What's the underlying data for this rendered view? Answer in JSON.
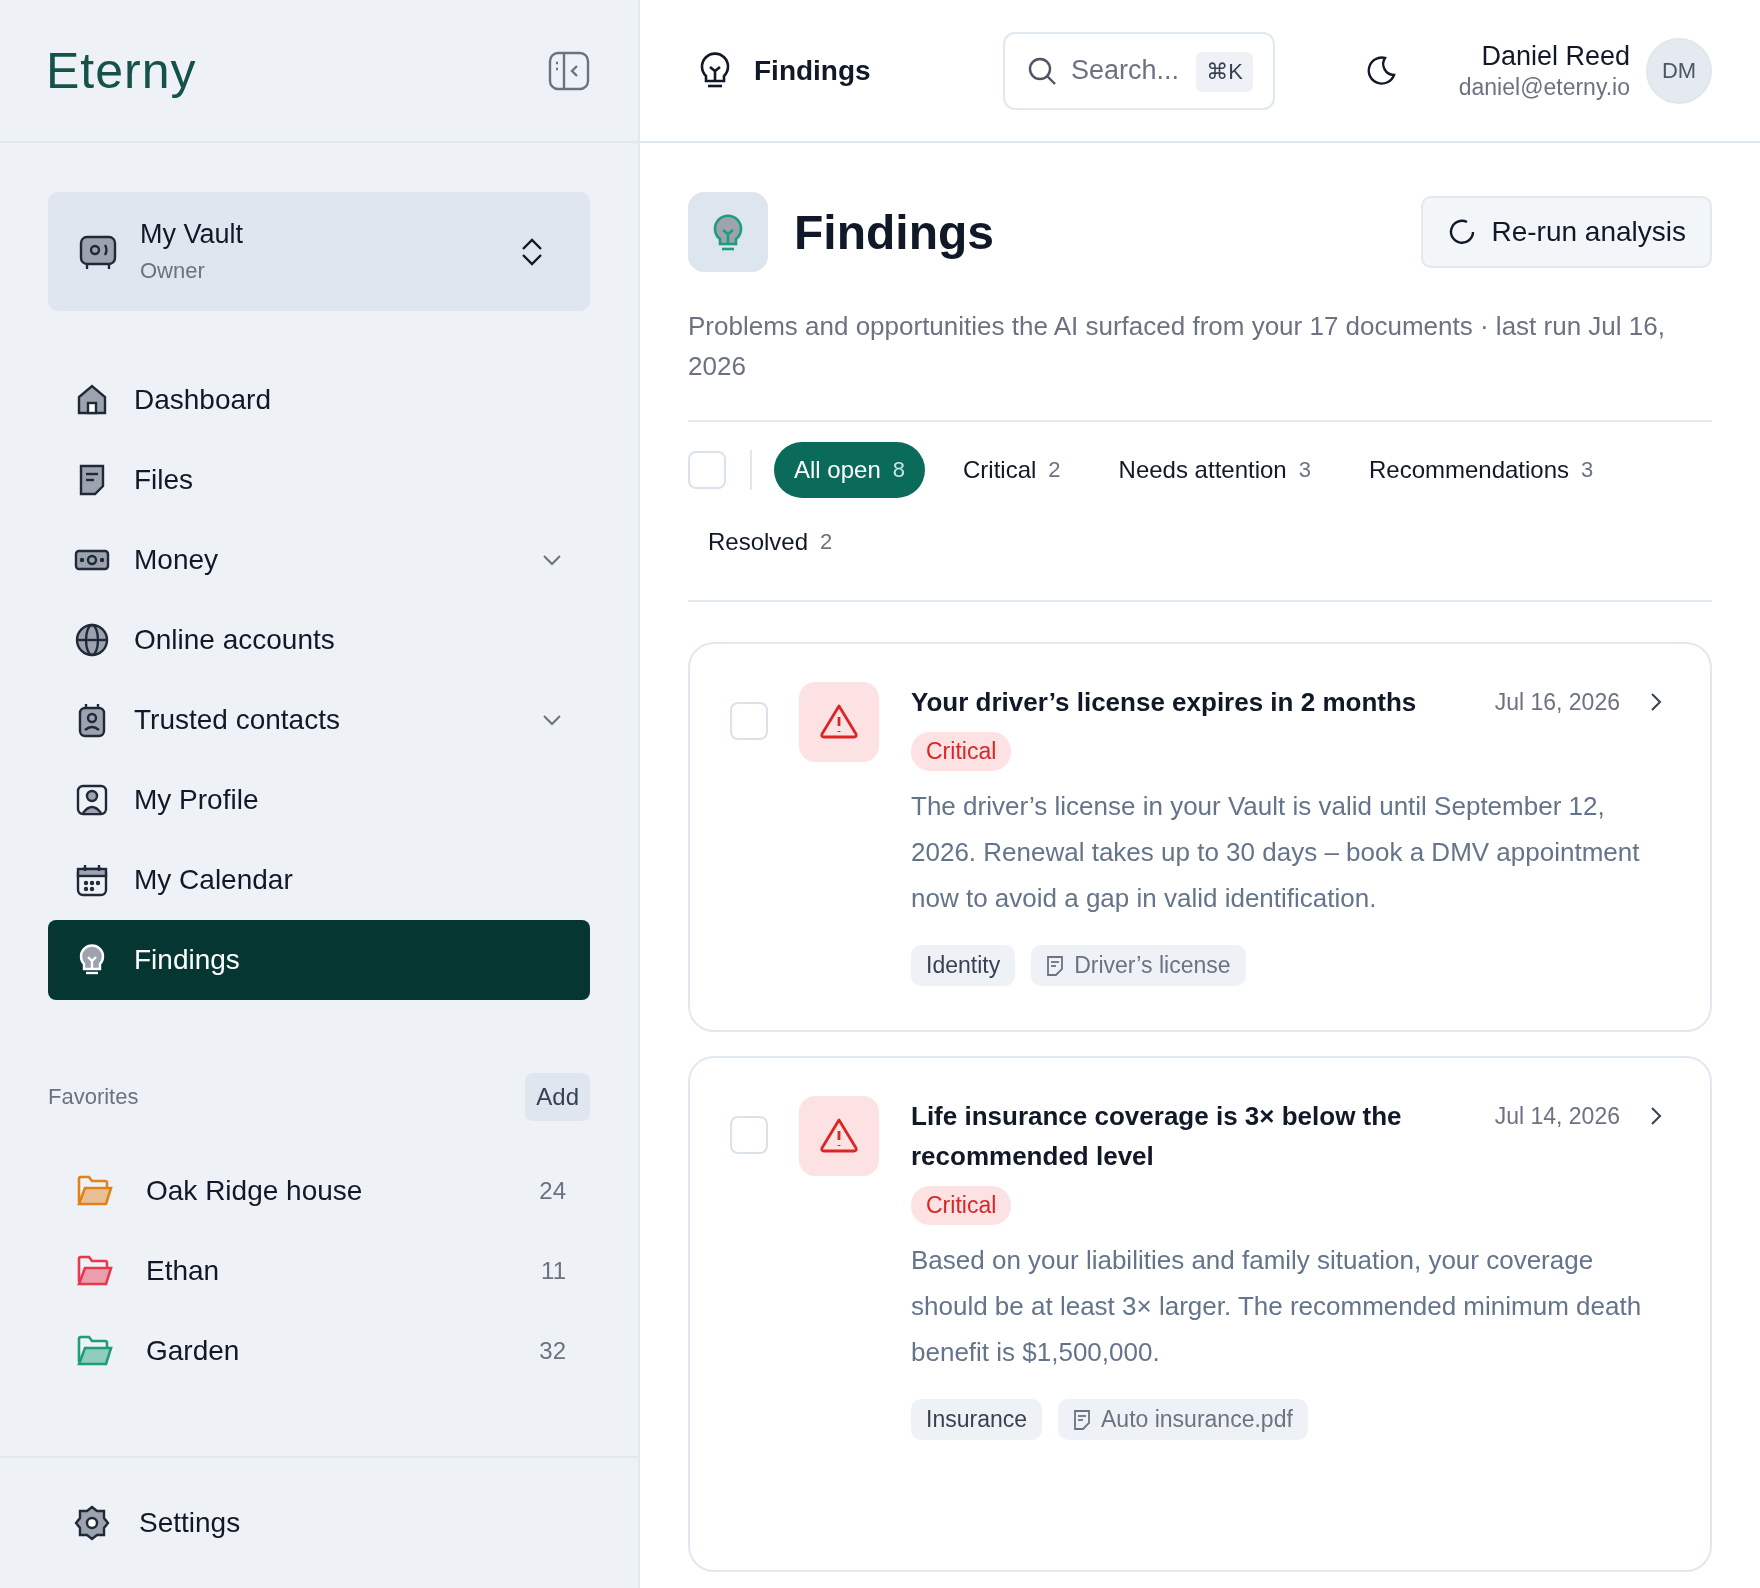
{
  "sidebar": {
    "logo": "Eterny",
    "vault": {
      "name": "My Vault",
      "role": "Owner"
    },
    "nav": [
      {
        "label": "Dashboard",
        "kind": "link",
        "selected": false
      },
      {
        "label": "Files",
        "kind": "link",
        "selected": false
      },
      {
        "label": "Money",
        "kind": "group",
        "selected": false
      },
      {
        "label": "Online accounts",
        "kind": "link",
        "selected": false
      },
      {
        "label": "Trusted contacts",
        "kind": "group",
        "selected": false
      },
      {
        "label": "My Profile",
        "kind": "link",
        "selected": false
      },
      {
        "label": "My Calendar",
        "kind": "link",
        "selected": false
      },
      {
        "label": "Findings",
        "kind": "link",
        "selected": true
      }
    ],
    "favorites": {
      "title": "Favorites",
      "add_button": "Add",
      "items": [
        {
          "name": "Oak Ridge house",
          "count": "24",
          "color": "#e0811a"
        },
        {
          "name": "Ethan",
          "count": "11",
          "color": "#e8384f"
        },
        {
          "name": "Garden",
          "count": "32",
          "color": "#1f9d7a"
        }
      ]
    },
    "settings": "Settings"
  },
  "header": {
    "title": "Findings",
    "search": {
      "placeholder": "Search...",
      "shortcut": "⌘K"
    },
    "user": {
      "name": "Daniel Reed",
      "email": "daniel@eterny.io",
      "initials": "DM"
    }
  },
  "page": {
    "title": "Findings",
    "rerun_button": "Re-run analysis",
    "subtitle": "Problems and opportunities the AI surfaced from your 17 documents · last run Jul 16, 2026",
    "select_all": {
      "checked": false
    },
    "tabs": [
      {
        "label": "All open",
        "count": "8",
        "selected": true
      },
      {
        "label": "Critical",
        "count": "2",
        "selected": false
      },
      {
        "label": "Needs attention",
        "count": "3",
        "selected": false
      },
      {
        "label": "Recommendations",
        "count": "3",
        "selected": false
      },
      {
        "label": "Resolved",
        "count": "2",
        "selected": false
      }
    ],
    "findings": [
      {
        "title": "Your driver’s license expires in 2 months",
        "date": "Jul 16, 2026",
        "checked": false,
        "kind": "critical",
        "badge": "Critical",
        "body": "The driver’s license in your Vault is valid until September 12, 2026. Renewal takes up to 30 days – book a DMV appointment now to avoid a gap in valid identification.",
        "tags": [
          {
            "kind": "category",
            "label": "Identity"
          },
          {
            "kind": "document",
            "label": "Driver’s license"
          }
        ]
      },
      {
        "title": "Life insurance coverage is 3× below the recommended level",
        "date": "Jul 14, 2026",
        "checked": false,
        "kind": "critical",
        "badge": "Critical",
        "body": "Based on your liabilities and family situation, your coverage should be at least 3× larger. The recommended minimum death benefit is $1,500,000.",
        "tags": [
          {
            "kind": "category",
            "label": "Insurance"
          },
          {
            "kind": "document",
            "label": "Auto insurance.pdf"
          }
        ]
      }
    ]
  }
}
